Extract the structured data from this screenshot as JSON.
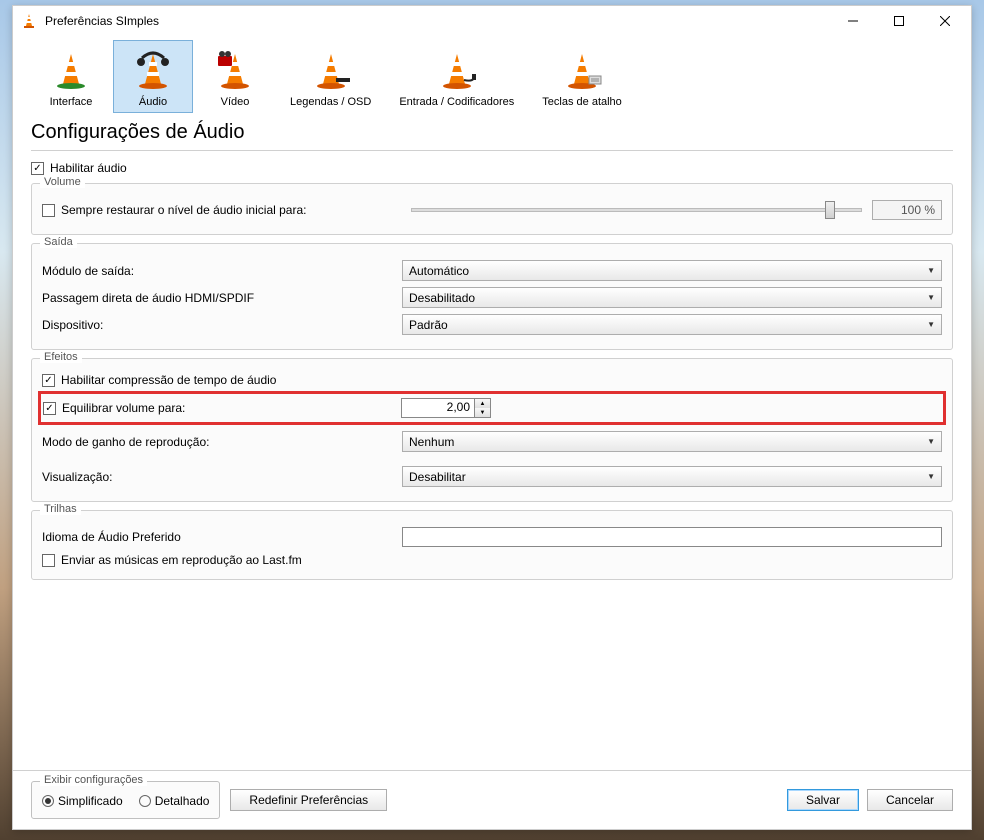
{
  "window": {
    "title": "Preferências SImples"
  },
  "tabs": {
    "interface": "Interface",
    "audio": "Áudio",
    "video": "Vídeo",
    "subtitles": "Legendas / OSD",
    "input": "Entrada / Codificadores",
    "hotkeys": "Teclas de atalho"
  },
  "page": {
    "title": "Configurações de Áudio"
  },
  "enable_audio": {
    "label": "Habilitar áudio",
    "checked": true
  },
  "volume": {
    "group": "Volume",
    "restore_label": "Sempre restaurar o nível de áudio inicial para:",
    "restore_checked": false,
    "pct": "100 %"
  },
  "output": {
    "group": "Saída",
    "module_label": "Módulo de saída:",
    "module_value": "Automático",
    "passthrough_label": "Passagem direta de áudio HDMI/SPDIF",
    "passthrough_value": "Desabilitado",
    "device_label": "Dispositivo:",
    "device_value": "Padrão"
  },
  "effects": {
    "group": "Efeitos",
    "time_stretch_label": "Habilitar compressão de tempo de áudio",
    "time_stretch_checked": true,
    "normalize_label": "Equilibrar volume para:",
    "normalize_checked": true,
    "normalize_value": "2,00",
    "replay_gain_label": "Modo de ganho de reprodução:",
    "replay_gain_value": "Nenhum",
    "visualization_label": "Visualização:",
    "visualization_value": "Desabilitar"
  },
  "tracks": {
    "group": "Trilhas",
    "preferred_label": "Idioma de Áudio Preferido",
    "preferred_value": "",
    "lastfm_label": "Enviar as músicas em reprodução ao Last.fm",
    "lastfm_checked": false
  },
  "footer": {
    "show_settings": "Exibir configurações",
    "simple": "Simplificado",
    "detailed": "Detalhado",
    "reset": "Redefinir Preferências",
    "save": "Salvar",
    "cancel": "Cancelar"
  }
}
